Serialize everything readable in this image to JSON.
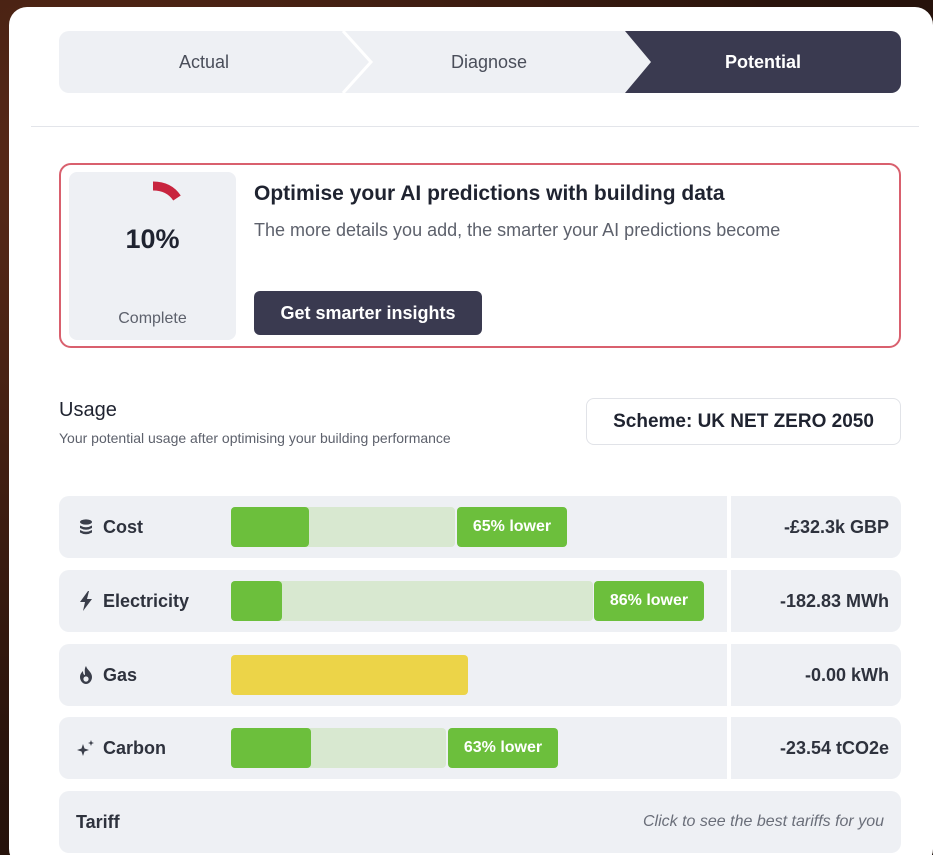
{
  "stepper": {
    "steps": [
      {
        "label": "Actual"
      },
      {
        "label": "Diagnose"
      },
      {
        "label": "Potential",
        "active": true
      }
    ]
  },
  "ai_card": {
    "progress_percent": 10,
    "progress_text": "10%",
    "progress_caption": "Complete",
    "title": "Optimise your AI predictions with building data",
    "subtitle": "The more details you add, the smarter your AI predictions become",
    "button_label": "Get smarter insights",
    "accent_color": "#d9606e"
  },
  "usage": {
    "title": "Usage",
    "subtitle": "Your potential usage after optimising your building performance",
    "scheme_label": "Scheme: UK NET ZERO 2050",
    "rows": [
      {
        "label": "Cost",
        "icon": "coins-icon",
        "fill_fraction": 0.35,
        "badge": "65% lower",
        "value": "-£32.3k GBP"
      },
      {
        "label": "Electricity",
        "icon": "lightning-icon",
        "fill_fraction": 0.14,
        "badge": "86% lower",
        "value": "-182.83 MWh"
      },
      {
        "label": "Gas",
        "icon": "flame-icon",
        "badge": "",
        "value": "-0.00 kWh"
      },
      {
        "label": "Carbon",
        "icon": "sparkle-icon",
        "fill_fraction": 0.37,
        "badge": "63% lower",
        "value": "-23.54 tCO2e"
      }
    ],
    "tariff": {
      "label": "Tariff",
      "hint": "Click to see the best tariffs for you"
    }
  },
  "colors": {
    "dark": "#3a3a50",
    "green": "#6cbf3c",
    "green_light": "#d8e8d0",
    "yellow": "#ecd448",
    "row_bg": "#eef0f4"
  }
}
